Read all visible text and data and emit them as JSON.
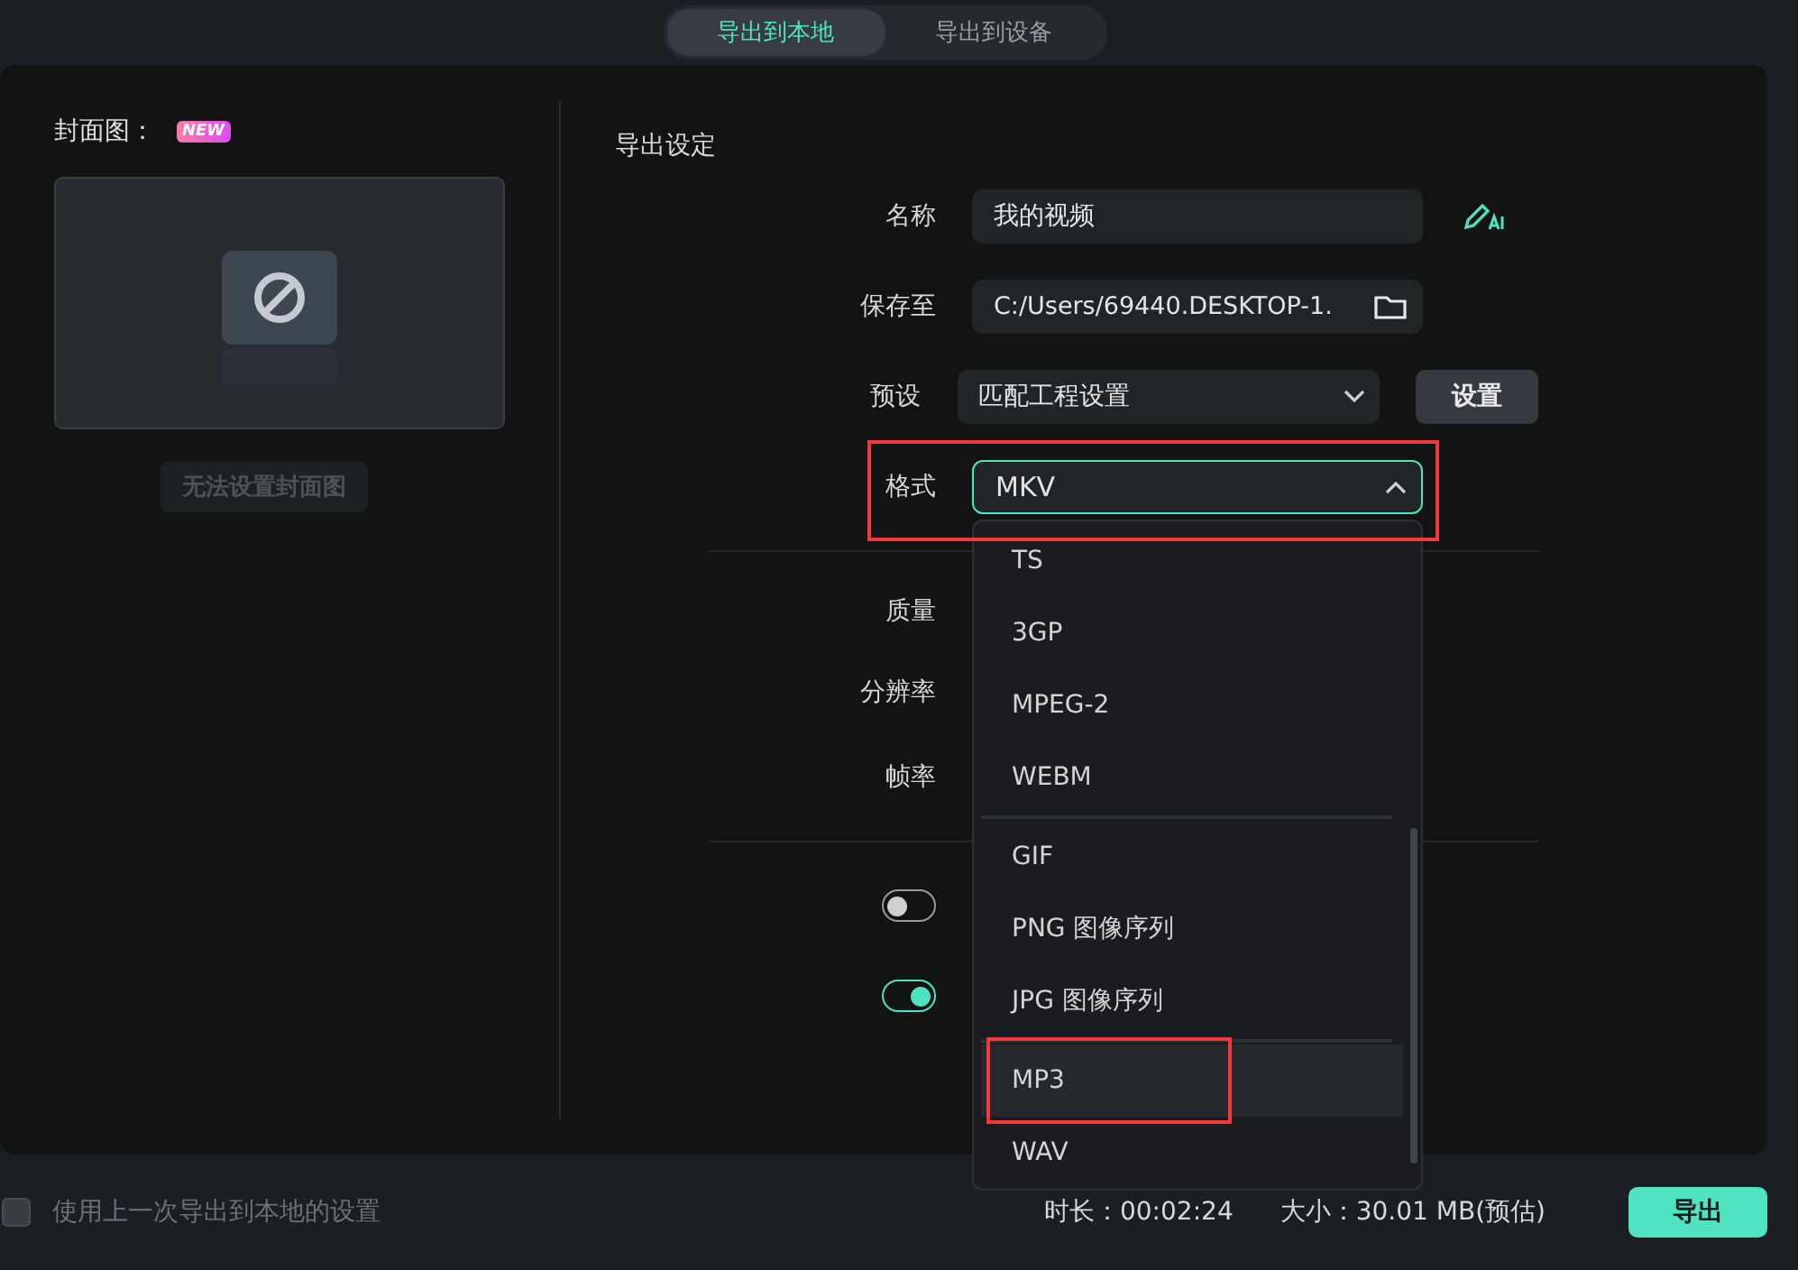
{
  "tabs": [
    {
      "label": "导出到本地",
      "selected": true
    },
    {
      "label": "导出到设备",
      "selected": false
    }
  ],
  "cover": {
    "title": "封面图：",
    "badge": "NEW",
    "button": {
      "label": "无法设置封面图",
      "disabled": true
    }
  },
  "settings": {
    "title": "导出设定",
    "name": {
      "label": "名称",
      "value": "我的视频"
    },
    "save_to": {
      "label": "保存至",
      "value": "C:/Users/69440.DESKTOP-1."
    },
    "preset": {
      "label": "预设",
      "value": "匹配工程设置",
      "button": "设置"
    },
    "format": {
      "label": "格式",
      "value": "MKV",
      "expanded": true
    },
    "quality": {
      "label": "质量"
    },
    "resolution": {
      "label": "分辨率"
    },
    "frame_rate": {
      "label": "帧率"
    },
    "toggles": [
      {
        "on": false
      },
      {
        "on": true
      }
    ]
  },
  "format_menu": {
    "groups": [
      {
        "options": [
          {
            "label": "TS",
            "highlighted": false
          },
          {
            "label": "3GP",
            "highlighted": false
          },
          {
            "label": "MPEG-2",
            "highlighted": false
          },
          {
            "label": "WEBM",
            "highlighted": false
          }
        ]
      },
      {
        "options": [
          {
            "label": "GIF",
            "highlighted": false
          },
          {
            "label": "PNG 图像序列",
            "highlighted": false
          },
          {
            "label": "JPG 图像序列",
            "highlighted": false
          }
        ]
      },
      {
        "options": [
          {
            "label": "MP3",
            "highlighted": true
          },
          {
            "label": "WAV",
            "highlighted": false
          }
        ]
      }
    ]
  },
  "footer": {
    "remember": {
      "label": "使用上一次导出到本地的设置",
      "checked": false
    },
    "duration": "时长：00:02:24",
    "size": "大小：30.01 MB(预估)",
    "export_button": "导出"
  }
}
